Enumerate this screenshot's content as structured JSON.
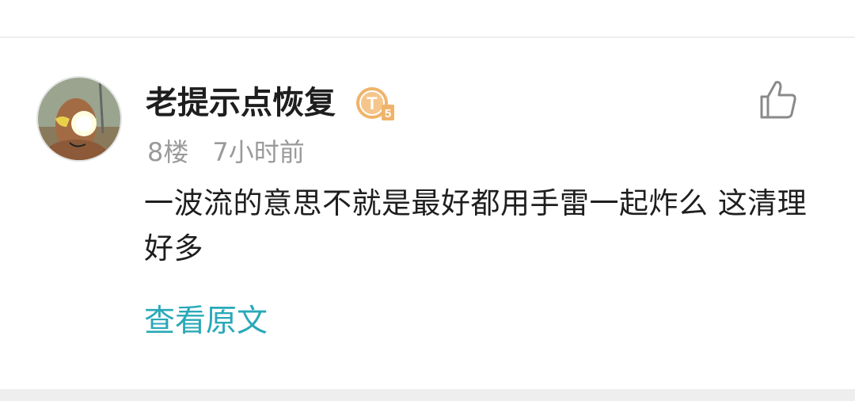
{
  "comment": {
    "username": "老提示点恢复",
    "badge_icon": "level-badge-icon",
    "badge_text": "T",
    "badge_level": "5",
    "floor": "8楼",
    "time": "7小时前",
    "text": "一波流的意思不就是最好都用手雷一起炸么 这清理好多",
    "view_original_label": "查看原文",
    "like_icon": "thumbs-up-icon"
  },
  "colors": {
    "link": "#29a9b8",
    "meta": "#9a9a9a",
    "text": "#1e1e1e",
    "divider": "#eeeeee",
    "badge": "#f0b36a"
  }
}
